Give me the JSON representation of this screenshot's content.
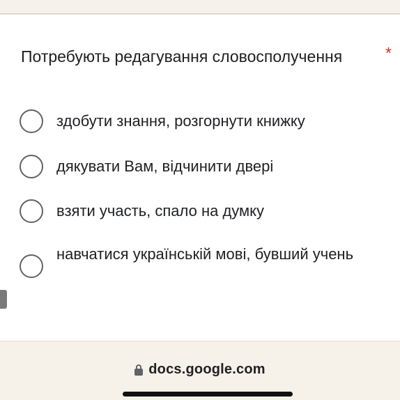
{
  "question": {
    "title": "Потребують редагування словосполучення",
    "required_mark": "*"
  },
  "options": [
    {
      "label": "здобути знання, розгорнути книжку",
      "selected": false
    },
    {
      "label": "дякувати Вам, відчинити двері",
      "selected": false
    },
    {
      "label": "взяти участь, спало на думку",
      "selected": false
    },
    {
      "label": "навчатися українській мові, бувший учень",
      "selected": false
    }
  ],
  "browser": {
    "url": "docs.google.com",
    "lock_icon": "lock-icon"
  },
  "colors": {
    "required": "#d93025",
    "radio_border": "#5f6368",
    "background": "#f6f1e9"
  }
}
